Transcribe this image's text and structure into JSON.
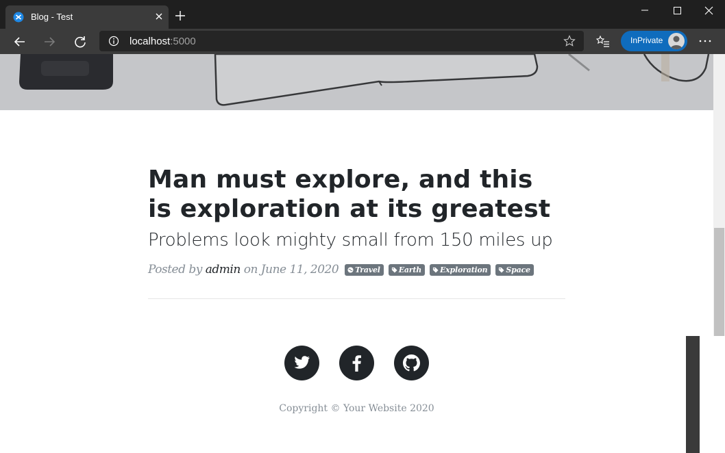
{
  "browser": {
    "tab_title": "Blog - Test",
    "url_host": "localhost",
    "url_port": ":5000",
    "inprivate_label": "InPrivate"
  },
  "post": {
    "title": "Man must explore, and this is exploration at its greatest",
    "subtitle": "Problems look mighty small from 150 miles up",
    "meta_posted_by": "Posted by",
    "meta_author": "admin",
    "meta_date": "on June 11, 2020",
    "tags": [
      {
        "label": "Travel",
        "icon": "globe-icon"
      },
      {
        "label": "Earth",
        "icon": "tag-icon"
      },
      {
        "label": "Exploration",
        "icon": "tag-icon"
      },
      {
        "label": "Space",
        "icon": "tag-icon"
      }
    ]
  },
  "footer": {
    "social": [
      "twitter-icon",
      "facebook-icon",
      "github-icon"
    ],
    "copyright": "Copyright © Your Website 2020"
  },
  "colors": {
    "chrome_dark": "#1f1f1f",
    "chrome_toolbar": "#3b3b3b",
    "inprivate_blue": "#0f6cbd",
    "text_dark": "#212529",
    "text_muted": "#868e96",
    "tag_bg": "#6c757d"
  }
}
